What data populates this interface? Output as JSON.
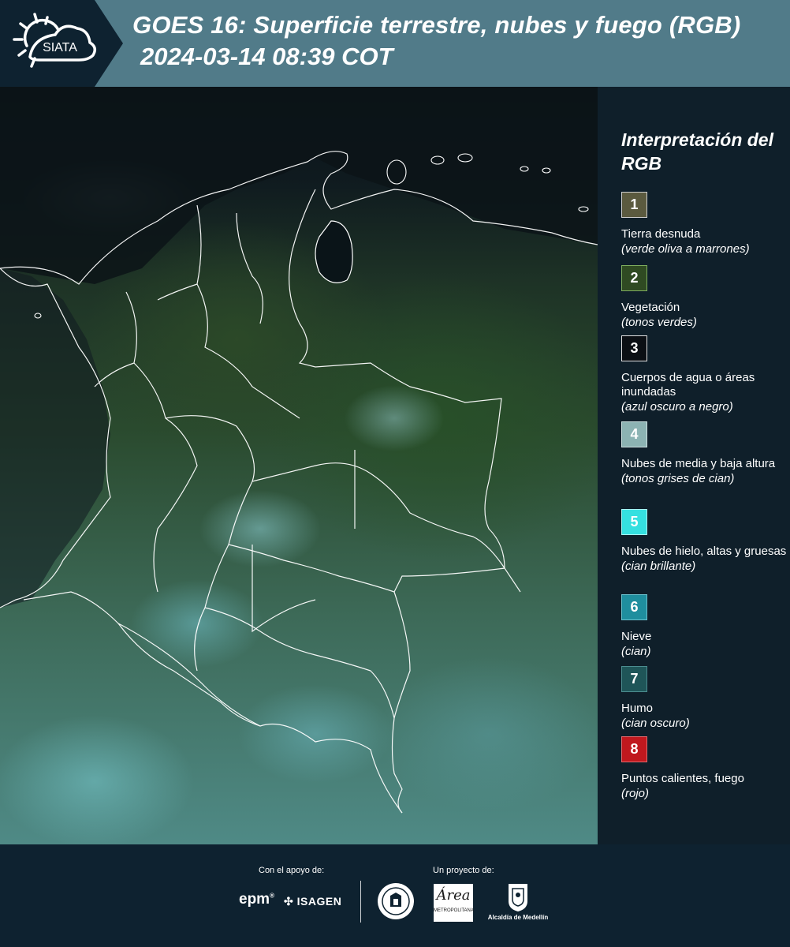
{
  "header": {
    "logo_text": "SIATA",
    "title_line1": "GOES 16: Superficie terrestre, nubes y fuego (RGB)",
    "title_line2": "2024-03-14 08:39 COT"
  },
  "map": {
    "description_icon": "satellite-image"
  },
  "legend": {
    "title": "Interpretación del RGB",
    "items": [
      {
        "number": "1",
        "label": "Tierra desnuda",
        "note": "(verde oliva a marrones)",
        "color": "#5b5a3f"
      },
      {
        "number": "2",
        "label": "Vegetación",
        "note": "(tonos verdes)",
        "color": "#2f4a22"
      },
      {
        "number": "3",
        "label": "Cuerpos de agua o áreas inundadas",
        "note": "(azul oscuro a negro)",
        "color": "#0b0f14"
      },
      {
        "number": "4",
        "label": "Nubes de media y baja altura",
        "note": "(tonos grises de cian)",
        "color": "#8cb3b3"
      },
      {
        "number": "5",
        "label": "Nubes de hielo, altas y gruesas",
        "note": "(cian brillante)",
        "color": "#35e0e0"
      },
      {
        "number": "6",
        "label": "Nieve",
        "note": "(cian)",
        "color": "#1f8e9e"
      },
      {
        "number": "7",
        "label": "Humo",
        "note": "(cian oscuro)",
        "color": "#1f5558"
      },
      {
        "number": "8",
        "label": "Puntos calientes, fuego",
        "note": "(rojo)",
        "color": "#c0181e"
      }
    ]
  },
  "footer": {
    "support_label": "Con el apoyo de:",
    "project_label": "Un proyecto de:",
    "epm": "epm",
    "isagen": "ISAGEN",
    "area_name": "Área",
    "area_sub": "METROPOLITANA",
    "medellin": "Alcaldía de Medellín"
  }
}
